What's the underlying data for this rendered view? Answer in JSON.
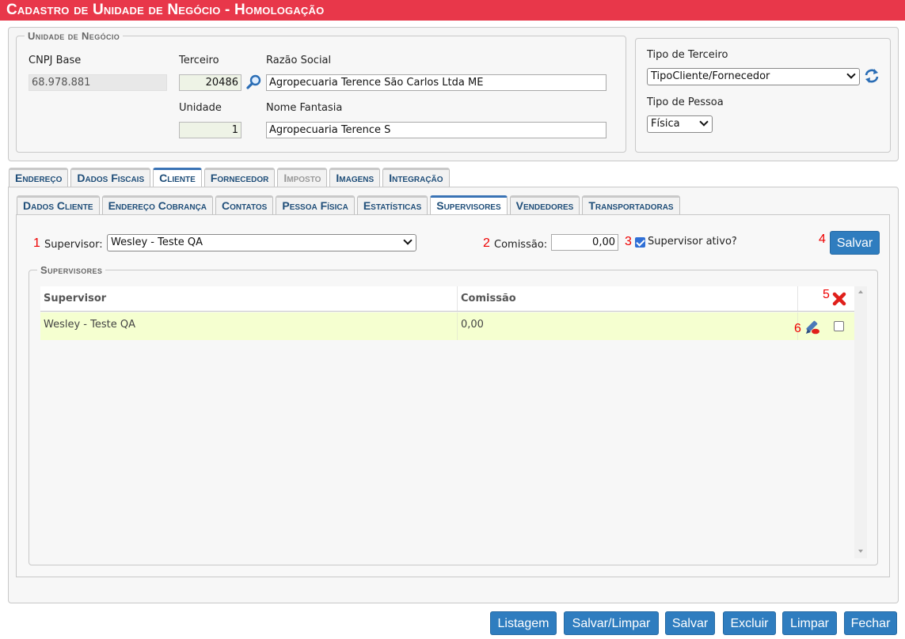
{
  "window": {
    "title": "Cadastro de Unidade de Negócio  - Homologação"
  },
  "unidade": {
    "legend": "Unidade de Negócio",
    "cnpj_label": "CNPJ Base",
    "cnpj_value": "68.978.881",
    "terceiro_label": "Terceiro",
    "terceiro_value": "20486",
    "razao_label": "Razão Social",
    "razao_value": "Agropecuaria Terence São Carlos Ltda ME",
    "unidade_label": "Unidade",
    "unidade_value": "1",
    "fantasia_label": "Nome Fantasia",
    "fantasia_value": "Agropecuaria Terence S"
  },
  "tipo": {
    "terceiro_label": "Tipo de Terceiro",
    "terceiro_value": "TipoCliente/Fornecedor",
    "pessoa_label": "Tipo de Pessoa",
    "pessoa_value": "Física"
  },
  "tabs": [
    {
      "label": "Endereço"
    },
    {
      "label": "Dados Fiscais"
    },
    {
      "label": "Cliente"
    },
    {
      "label": "Fornecedor"
    },
    {
      "label": "Imposto"
    },
    {
      "label": "Imagens"
    },
    {
      "label": "Integração"
    }
  ],
  "subtabs": [
    {
      "label": "Dados Cliente"
    },
    {
      "label": "Endereço Cobrança"
    },
    {
      "label": "Contatos"
    },
    {
      "label": "Pessoa Física"
    },
    {
      "label": "Estatísticas"
    },
    {
      "label": "Supervisores"
    },
    {
      "label": "Vendedores"
    },
    {
      "label": "Transportadoras"
    }
  ],
  "supervisor_form": {
    "supervisor_label": "Supervisor:",
    "supervisor_value": "Wesley - Teste QA",
    "comissao_label": "Comissão:",
    "comissao_value": "0,00",
    "ativo_label": "Supervisor ativo?",
    "salvar_label": "Salvar"
  },
  "markers": [
    "1",
    "2",
    "3",
    "4",
    "5",
    "6"
  ],
  "grid": {
    "legend": "Supervisores",
    "columns": [
      "Supervisor",
      "Comissão"
    ],
    "rows": [
      {
        "supervisor": "Wesley - Teste QA",
        "comissao": "0,00"
      }
    ]
  },
  "footer": {
    "listagem": "Listagem",
    "salvar_limpar": "Salvar/Limpar",
    "salvar": "Salvar",
    "excluir": "Excluir",
    "limpar": "Limpar",
    "fechar": "Fechar"
  },
  "colors": {
    "titlebar": "#e8374a",
    "button": "#2f7dbf",
    "highlight_row": "#f5ffd0",
    "marker": "#e00000"
  },
  "icons": [
    "search-icon",
    "refresh-icon",
    "delete-all-icon",
    "edit-icon",
    "chevron-down-icon"
  ]
}
